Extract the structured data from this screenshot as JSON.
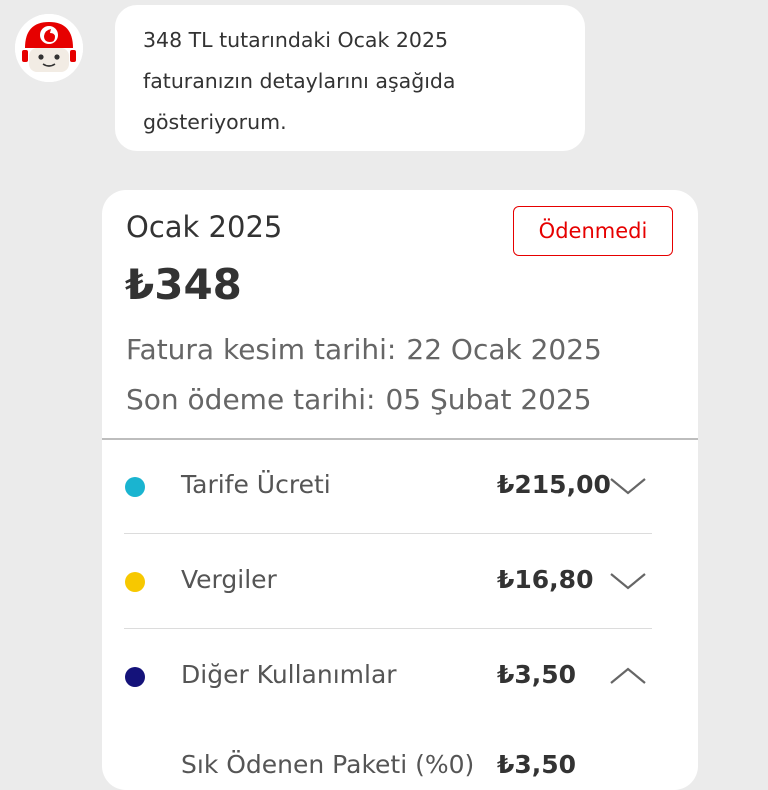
{
  "assistant": {
    "avatar_icon": "vodafone-robot-icon",
    "message": "348 TL tutarındaki Ocak 2025 faturanızın detaylarını aşağıda gösteriyorum."
  },
  "bill": {
    "period": "Ocak 2025",
    "status": "Ödenmedi",
    "amount": "₺348",
    "issue_date_label": "Fatura kesim tarihi:",
    "issue_date": "22 Ocak 2025",
    "due_date_label": "Son ödeme tarihi:",
    "due_date": "05 Şubat 2025",
    "items": [
      {
        "label": "Tarife Ücreti",
        "value": "₺215,00",
        "color": "#1ab4d0",
        "state": "collapsed"
      },
      {
        "label": "Vergiler",
        "value": "₺16,80",
        "color": "#f7c800",
        "state": "collapsed"
      },
      {
        "label": "Diğer Kullanımlar",
        "value": "₺3,50",
        "color": "#14127a",
        "state": "expanded"
      }
    ],
    "partial_row": {
      "label": "Sık Ödenen Paketi (%0)",
      "value": "₺3,50"
    }
  },
  "colors": {
    "accent": "#e60000",
    "background": "#ebebeb"
  }
}
